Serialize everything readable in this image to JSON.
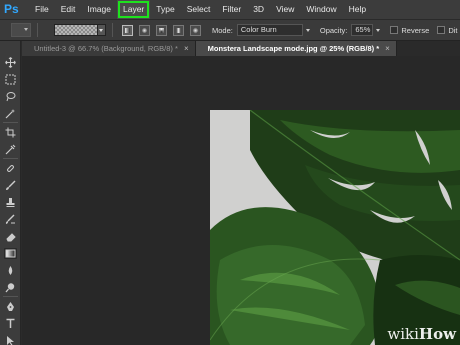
{
  "app": {
    "logo": "Ps"
  },
  "menu": {
    "items": [
      "File",
      "Edit",
      "Image",
      "Layer",
      "Type",
      "Select",
      "Filter",
      "3D",
      "View",
      "Window",
      "Help"
    ],
    "highlighted": "Layer",
    "highlight_color": "#1ee21e"
  },
  "options": {
    "mode_label": "Mode:",
    "mode_value": "Color Burn",
    "opacity_label": "Opacity:",
    "opacity_value": "65%",
    "reverse_label": "Reverse",
    "dither_label": "Dit"
  },
  "tabs": [
    {
      "title": "Untitled-3 @ 66.7% (Background, RGB/8) *",
      "active": false
    },
    {
      "title": "Monstera Landscape mode.jpg @ 25% (RGB/8) *",
      "active": true
    }
  ],
  "tab_close_glyph": "×",
  "tools": [
    "move-icon",
    "marquee-icon",
    "lasso-icon",
    "magic-wand-icon",
    "crop-icon",
    "eyedropper-icon",
    "healing-brush-icon",
    "brush-icon",
    "clone-stamp-icon",
    "history-brush-icon",
    "eraser-icon",
    "gradient-icon",
    "blur-icon",
    "dodge-icon",
    "pen-icon",
    "type-icon",
    "path-selection-icon"
  ],
  "watermark": {
    "wiki": "wiki",
    "how": "How"
  },
  "colors": {
    "accent_ps": "#31a8ff",
    "leaf_dark": "#1f3d18",
    "leaf_mid": "#2e5a1f",
    "canvas_bg": "#d0d0cf"
  }
}
